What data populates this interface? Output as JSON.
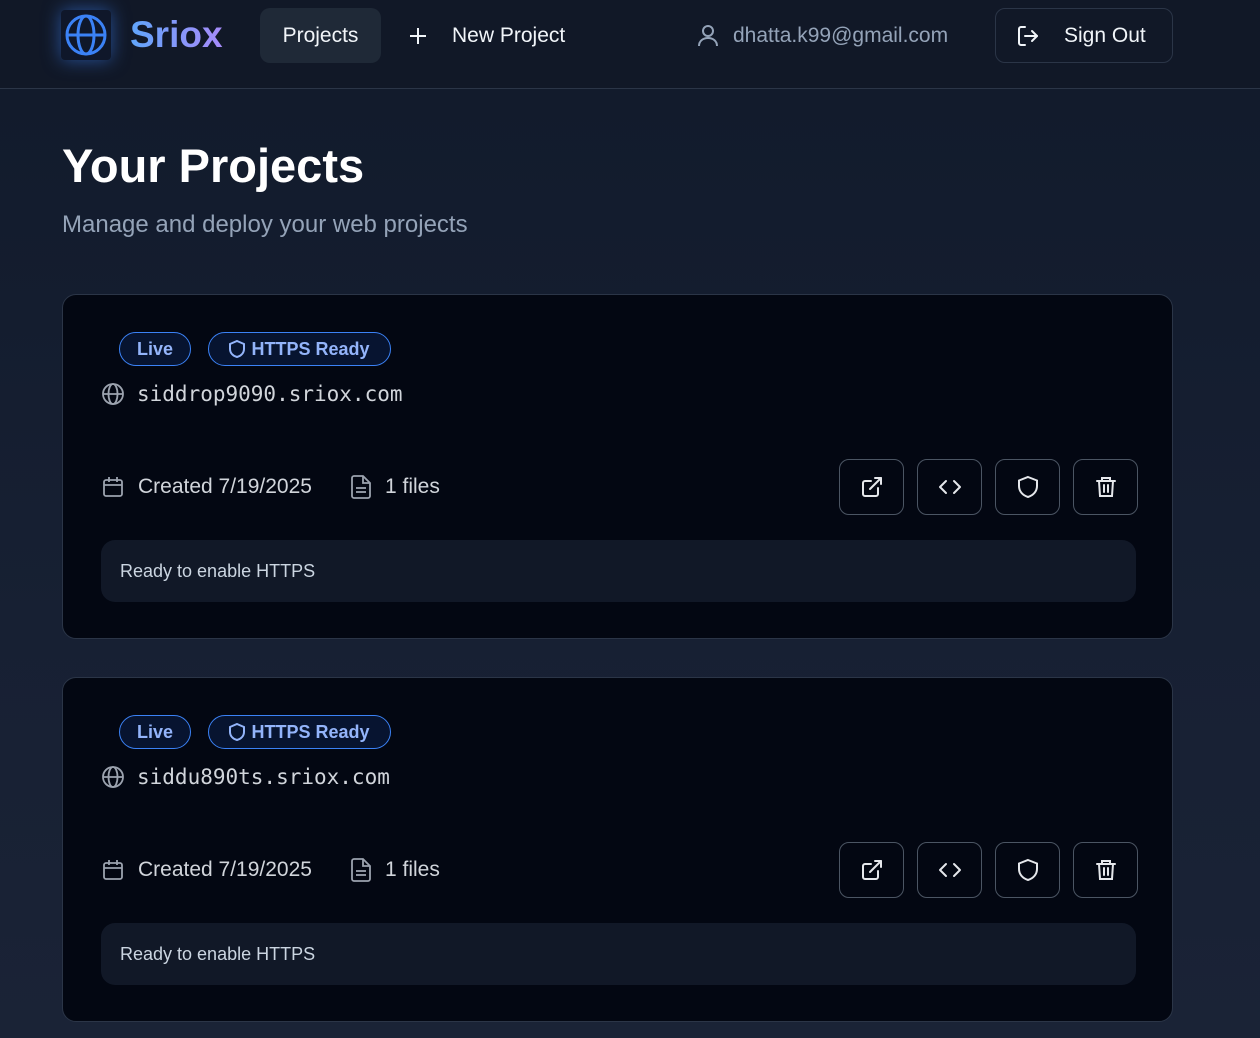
{
  "header": {
    "brand": "Sriox",
    "nav_projects": "Projects",
    "nav_new_project": "New Project",
    "user_email": "dhatta.k99@gmail.com",
    "sign_out": "Sign Out"
  },
  "page": {
    "title": "Your Projects",
    "subtitle": "Manage and deploy your web projects"
  },
  "projects": [
    {
      "badge_live": "Live",
      "badge_https": "HTTPS Ready",
      "domain": "siddrop9090.sriox.com",
      "created": "Created 7/19/2025",
      "files": "1 files",
      "status": "Ready to enable HTTPS"
    },
    {
      "badge_live": "Live",
      "badge_https": "HTTPS Ready",
      "domain": "siddu890ts.sriox.com",
      "created": "Created 7/19/2025",
      "files": "1 files",
      "status": "Ready to enable HTTPS"
    }
  ],
  "colors": {
    "accent": "#3b82f6",
    "card_bg": "#030712",
    "page_bg": "#172033"
  }
}
